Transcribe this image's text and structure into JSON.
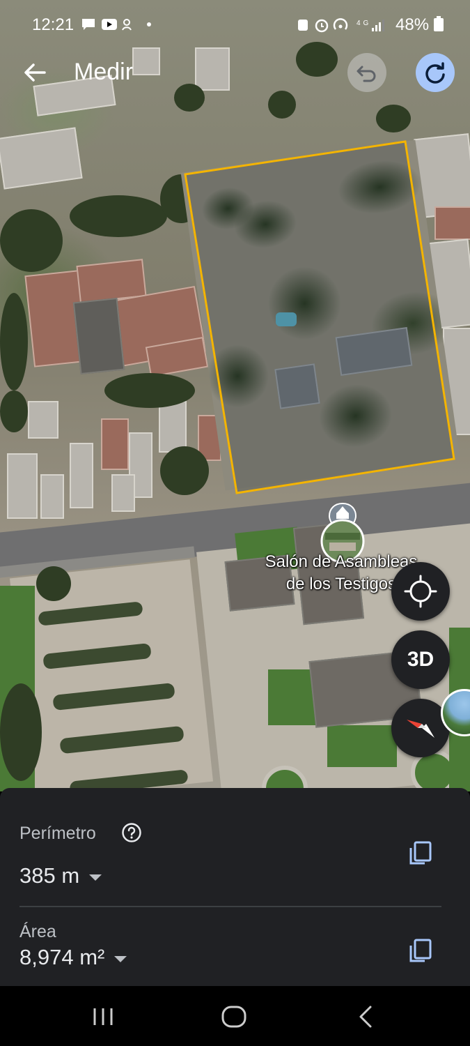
{
  "status_bar": {
    "time": "12:21",
    "battery": "48%"
  },
  "header": {
    "title": "Medir",
    "back_icon": "arrow-back-icon",
    "undo_icon": "undo-icon",
    "redo_icon": "redo-icon"
  },
  "map": {
    "place_label": "Salón de Asambleas de los Testigos",
    "place_label_line1": "Salón de Asambleas",
    "place_label_line2": "de los Testigos",
    "polygon_color": "#f4b400"
  },
  "controls": {
    "locate_icon": "my-location-icon",
    "three_d_label": "3D",
    "compass_icon": "compass-icon"
  },
  "measurements": {
    "perimeter_label": "Perímetro",
    "perimeter_value": "385 m",
    "area_label": "Área",
    "area_value": "8,974 m²"
  },
  "colors": {
    "accent": "#a8c7fa",
    "panel_bg": "#202124",
    "copy_icon": "#a8c7fa"
  }
}
